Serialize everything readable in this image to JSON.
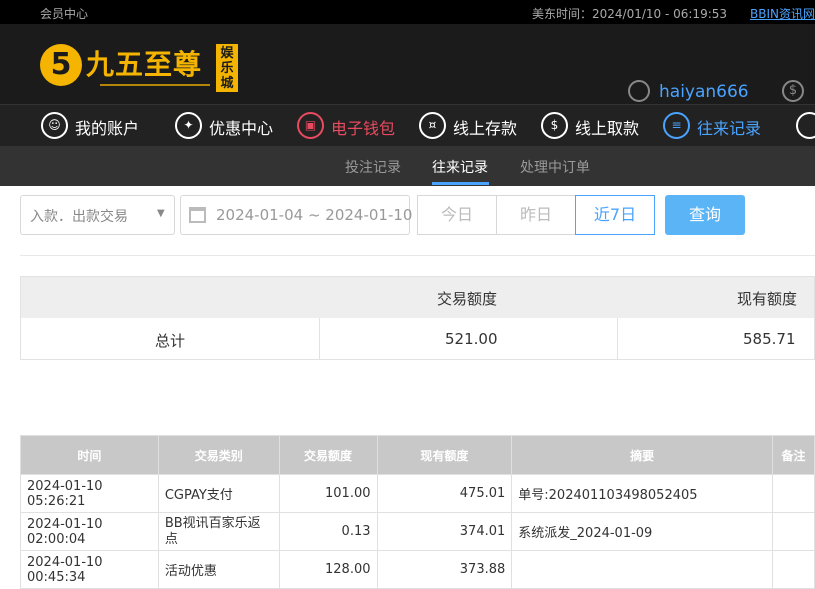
{
  "topbar": {
    "member": "会员中心",
    "clock": "美东时间：2024/01/10 - 06:19:53",
    "bbin_link": "BBIN资讯网"
  },
  "header": {
    "logo_mark": "5",
    "logo_name": "九五至尊",
    "logo_stamp": "娱乐城",
    "username": "haiyan666",
    "currency_icon": "$"
  },
  "nav": [
    {
      "label": "我的账户",
      "icon": "user-icon",
      "glyph": "☺"
    },
    {
      "label": "优惠中心",
      "icon": "gift-icon",
      "glyph": "✦"
    },
    {
      "label": "电子钱包",
      "icon": "wallet-icon",
      "glyph": "▣"
    },
    {
      "label": "线上存款",
      "icon": "deposit-icon",
      "glyph": "¤"
    },
    {
      "label": "线上取款",
      "icon": "withdraw-icon",
      "glyph": "$"
    },
    {
      "label": "往来记录",
      "icon": "records-icon",
      "glyph": "≡"
    }
  ],
  "subnav": {
    "bet_records": "投注记录",
    "transactions": "往来记录",
    "pending_orders": "处理中订单"
  },
  "filter": {
    "type": "入款．出款交易",
    "date_range": "2024-01-04 ~ 2024-01-10",
    "today": "今日",
    "yesterday": "昨日",
    "last7": "近7日",
    "query": "查询"
  },
  "summary": {
    "col_amount": "交易额度",
    "col_balance": "现有额度",
    "total_label": "总计",
    "total_amount": "521.00",
    "total_balance": "585.71"
  },
  "table": {
    "headers": [
      "时间",
      "交易类别",
      "交易额度",
      "现有额度",
      "摘要",
      "备注"
    ],
    "rows": [
      {
        "time": "2024-01-10 05:26:21",
        "type": "CGPAY支付",
        "amount": "101.00",
        "balance": "475.01",
        "memo": "单号:202401103498052405",
        "note": ""
      },
      {
        "time": "2024-01-10 02:00:04",
        "type": "BB视讯百家乐返点",
        "amount": "0.13",
        "balance": "374.01",
        "memo": "系统派发_2024-01-09",
        "note": ""
      },
      {
        "time": "2024-01-10 00:45:34",
        "type": "活动优惠",
        "amount": "128.00",
        "balance": "373.88",
        "memo": "",
        "note": ""
      }
    ]
  },
  "colors": {
    "accent": "#4aa3ff",
    "gold": "#f4b400",
    "wallet_red": "#e84a5f",
    "query_btn": "#5bb4f5",
    "header_bg": "#1b1b1b",
    "table_header": "#c8c8c8"
  }
}
